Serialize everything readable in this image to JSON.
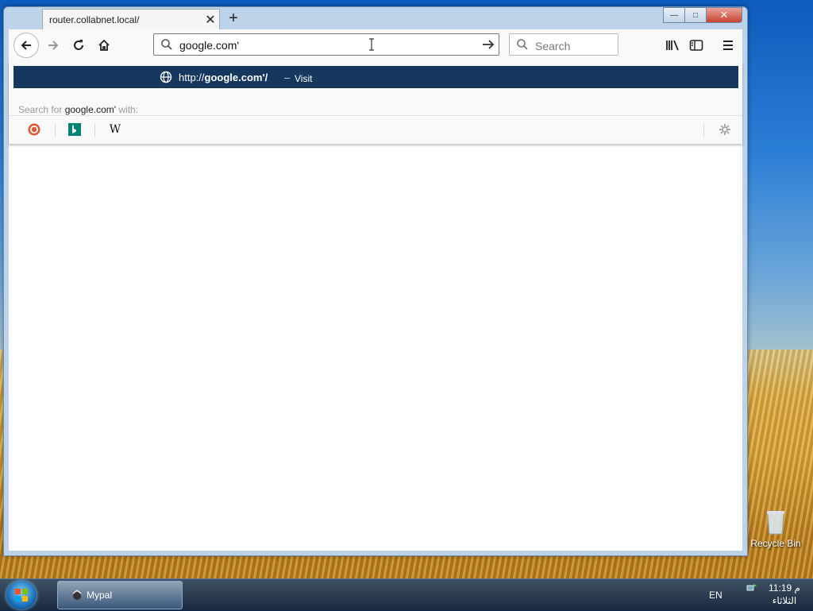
{
  "browser": {
    "tab": {
      "title": "router.collabnet.local/",
      "close_label": "✕"
    },
    "new_tab_label": "+",
    "window_controls": {
      "minimize": "—",
      "maximize": "□",
      "close": "✕"
    },
    "urlbar": {
      "value": "google.com'"
    },
    "searchbar": {
      "placeholder": "Search"
    },
    "dropdown": {
      "suggestion": {
        "url_prefix": "http://",
        "url_host": "google.com'/",
        "separator": "–",
        "action": "Visit"
      },
      "search_with": {
        "prefix": "Search for",
        "query": "google.com'",
        "suffix": "with:"
      },
      "engines": [
        "duckduckgo-icon",
        "bing-icon",
        "wikipedia-icon"
      ],
      "wikipedia_glyph": "W"
    }
  },
  "desktop": {
    "recycle_bin_label": "Recycle Bin"
  },
  "taskbar": {
    "task_label": "Mypal",
    "language": "EN",
    "clock_time": "11:19 م",
    "clock_day": "الثلاثاء"
  },
  "colors": {
    "accent": "#16385f",
    "taskbar": "#1c3558"
  }
}
